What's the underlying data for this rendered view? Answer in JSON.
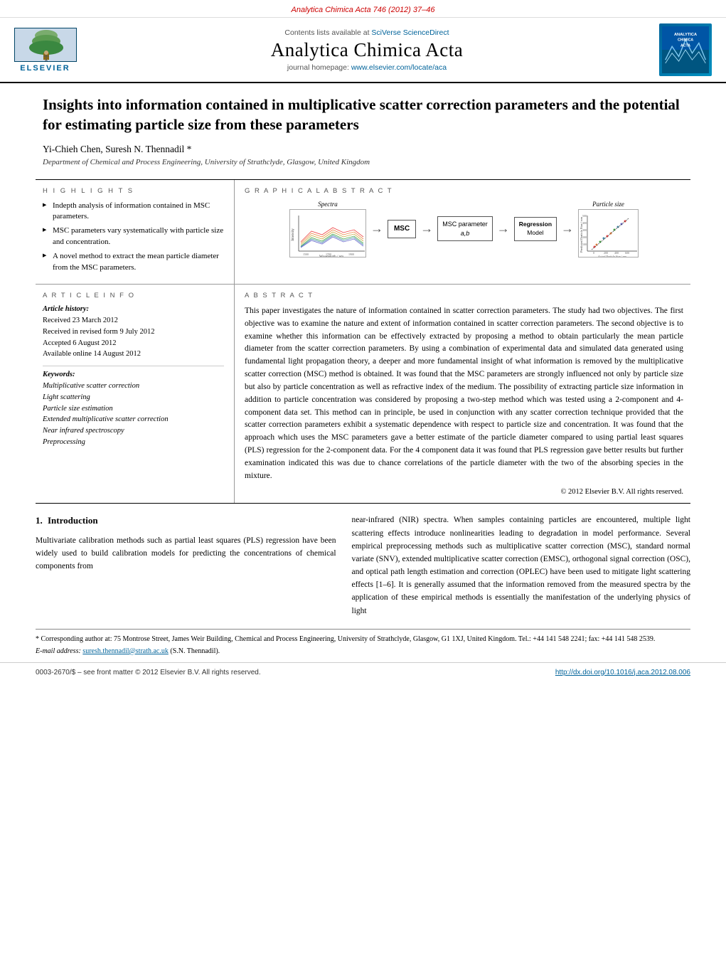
{
  "journal_header": {
    "citation": "Analytica Chimica Acta 746 (2012) 37–46"
  },
  "header": {
    "sciverse_text": "Contents lists available at",
    "sciverse_link": "SciVerse ScienceDirect",
    "journal_title": "Analytica Chimica Acta",
    "homepage_text": "journal homepage:",
    "homepage_link": "www.elsevier.com/locate/aca",
    "elsevier_label": "ELSEVIER",
    "analytics_label": "ANALYTICA\nCHIMICA\nACTA"
  },
  "article": {
    "title": "Insights into information contained in multiplicative scatter correction parameters and the potential for estimating particle size from these parameters",
    "authors": "Yi-Chieh Chen, Suresh N. Thennadil *",
    "affiliation": "Department of Chemical and Process Engineering, University of Strathclyde, Glasgow, United Kingdom",
    "highlights_label": "H I G H L I G H T S",
    "highlights": [
      "Indepth analysis of information contained in MSC parameters.",
      "MSC parameters vary systematically with particle size and concentration.",
      "A novel method to extract the mean particle diameter from the MSC parameters."
    ],
    "graphical_abstract_label": "G R A P H I C A L   A B S T R A C T",
    "ga": {
      "spectra_label": "Spectra",
      "msc_label": "MSC",
      "msc_param_label": "MSC parameter",
      "msc_param_sub": "a,b",
      "regression_label": "Regression\nModel",
      "particle_label": "Particle size"
    },
    "article_info": {
      "label": "A R T I C L E   I N F O",
      "history_label": "Article history:",
      "received": "Received 23 March 2012",
      "revised": "Received in revised form 9 July 2012",
      "accepted": "Accepted 6 August 2012",
      "online": "Available online 14 August 2012",
      "keywords_label": "Keywords:",
      "keywords": [
        "Multiplicative scatter correction",
        "Light scattering",
        "Particle size estimation",
        "Extended multiplicative scatter correction",
        "Near infrared spectroscopy",
        "Preprocessing"
      ]
    },
    "abstract": {
      "label": "A B S T R A C T",
      "text": "This paper investigates the nature of information contained in scatter correction parameters. The study had two objectives. The first objective was to examine the nature and extent of information contained in scatter correction parameters. The second objective is to examine whether this information can be effectively extracted by proposing a method to obtain particularly the mean particle diameter from the scatter correction parameters. By using a combination of experimental data and simulated data generated using fundamental light propagation theory, a deeper and more fundamental insight of what information is removed by the multiplicative scatter correction (MSC) method is obtained. It was found that the MSC parameters are strongly influenced not only by particle size but also by particle concentration as well as refractive index of the medium. The possibility of extracting particle size information in addition to particle concentration was considered by proposing a two-step method which was tested using a 2-component and 4-component data set. This method can in principle, be used in conjunction with any scatter correction technique provided that the scatter correction parameters exhibit a systematic dependence with respect to particle size and concentration. It was found that the approach which uses the MSC parameters gave a better estimate of the particle diameter compared to using partial least squares (PLS) regression for the 2-component data. For the 4 component data it was found that PLS regression gave better results but further examination indicated this was due to chance correlations of the particle diameter with the two of the absorbing species in the mixture.",
      "copyright": "© 2012 Elsevier B.V. All rights reserved."
    },
    "intro": {
      "number": "1.",
      "title": "Introduction",
      "text_left": "Multivariate calibration methods such as partial least squares (PLS) regression have been widely used to build calibration models for predicting the concentrations of chemical components from",
      "text_right": "near-infrared (NIR) spectra. When samples containing particles are encountered, multiple light scattering effects introduce nonlinearities leading to degradation in model performance. Several empirical preprocessing methods such as multiplicative scatter correction (MSC), standard normal variate (SNV), extended multiplicative scatter correction (EMSC), orthogonal signal correction (OSC), and optical path length estimation and correction (OPLEC) have been used to mitigate light scattering effects [1–6]. It is generally assumed that the information removed from the measured spectra by the application of these empirical methods is essentially the manifestation of the underlying physics of light"
    },
    "footnote": {
      "corresponding": "* Corresponding author at: 75 Montrose Street, James Weir Building, Chemical and Process Engineering, University of Strathclyde, Glasgow, G1 1XJ, United Kingdom. Tel.: +44 141 548 2241; fax: +44 141 548 2539.",
      "email_label": "E-mail address:",
      "email": "suresh.thennadil@strath.ac.uk",
      "email_suffix": "(S.N. Thennadil)."
    },
    "bottom": {
      "issn": "0003-2670/$ – see front matter © 2012 Elsevier B.V. All rights reserved.",
      "doi": "http://dx.doi.org/10.1016/j.aca.2012.08.006"
    }
  }
}
